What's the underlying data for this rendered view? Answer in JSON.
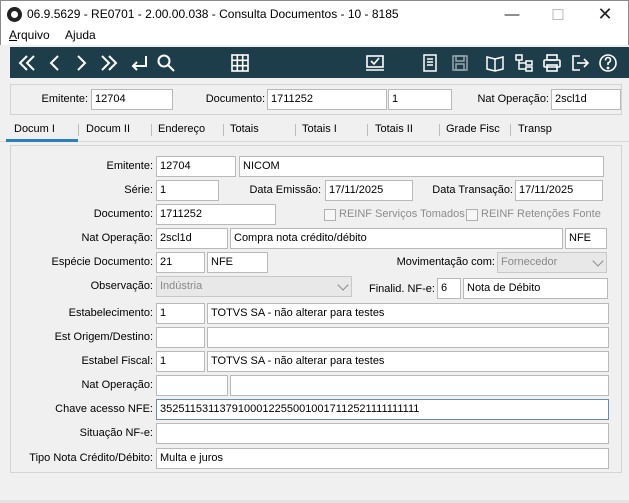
{
  "window": {
    "title": "06.9.5629 - RE0701 - 2.00.00.038 - Consulta Documentos - 10 - 8185"
  },
  "menu": {
    "arquivo": "Arquivo",
    "ajuda": "Ajuda"
  },
  "toolbar": {
    "icons": [
      "first-icon",
      "prev-icon",
      "next-icon",
      "last-icon",
      "return-icon",
      "search-icon",
      "grid-icon",
      "approve-icon",
      "report-icon",
      "save-icon",
      "book-icon",
      "tree-icon",
      "print-icon",
      "exit-icon",
      "help-icon"
    ]
  },
  "header": {
    "emitente_label": "Emitente:",
    "emitente_value": "12704",
    "documento_label": "Documento:",
    "documento_value": "1711252",
    "documento_seq": "1",
    "natop_label": "Nat Operação:",
    "natop_value": "2scl1d"
  },
  "tabs": [
    "Docum I",
    "Docum II",
    "Endereço",
    "Totais",
    "Totais I",
    "Totais II",
    "Grade Fisc",
    "Transp"
  ],
  "form": {
    "emitente_label": "Emitente:",
    "emitente_code": "12704",
    "emitente_name": "NICOM",
    "serie_label": "Série:",
    "serie_value": "1",
    "data_emissao_label": "Data Emissão:",
    "data_emissao_value": "17/11/2025",
    "data_transacao_label": "Data Transação:",
    "data_transacao_value": "17/11/2025",
    "documento_label": "Documento:",
    "documento_value": "1711252",
    "reinf_servicos_label": "REINF Serviços Tomados",
    "reinf_retencoes_label": "REINF Retenções Fonte",
    "natop_label": "Nat Operação:",
    "natop_code": "2scl1d",
    "natop_desc": "Compra nota crédito/débito",
    "natop_type": "NFE",
    "especie_label": "Espécie Documento:",
    "especie_code": "21",
    "especie_desc": "NFE",
    "movimentacao_label": "Movimentação com:",
    "movimentacao_value": "Fornecedor",
    "observacao_label": "Observação:",
    "observacao_value": "Indústria",
    "finalid_label": "Finalid. NF-e:",
    "finalid_code": "6",
    "finalid_desc": "Nota de Débito",
    "estabelecimento_label": "Estabelecimento:",
    "estabelecimento_code": "1",
    "estabelecimento_desc": "TOTVS SA - não alterar para testes",
    "est_origem_label": "Est Origem/Destino:",
    "est_origem_code": "",
    "est_origem_desc": "",
    "estabel_fiscal_label": "Estabel Fiscal:",
    "estabel_fiscal_code": "1",
    "estabel_fiscal_desc": "TOTVS SA - não alterar para testes",
    "natop2_label": "Nat Operação:",
    "natop2_code": "",
    "natop2_desc": "",
    "chave_label": "Chave acesso NFE:",
    "chave_value": "35251153113791000122550010017112521111111111",
    "situacao_label": "Situação NF-e:",
    "situacao_value": "",
    "tipo_nota_label": "Tipo Nota Crédito/Débito:",
    "tipo_nota_value": "Multa e juros"
  }
}
